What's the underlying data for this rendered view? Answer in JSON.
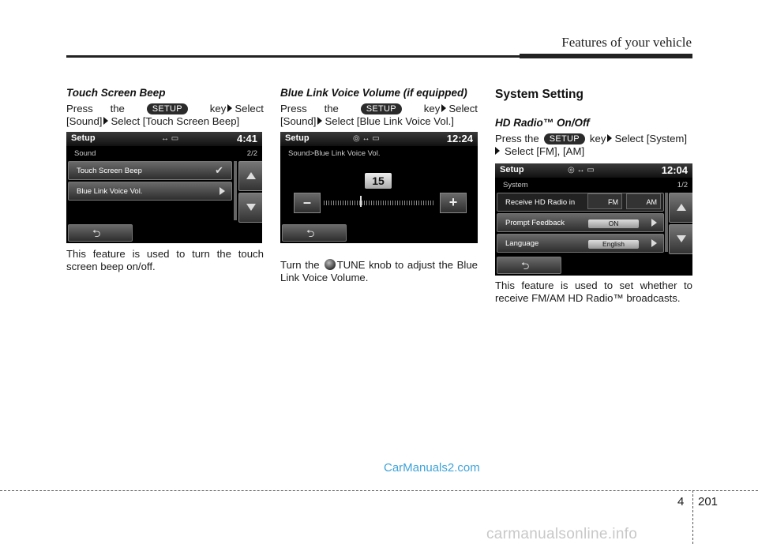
{
  "header": {
    "title": "Features of your vehicle"
  },
  "col1": {
    "subtitle": "Touch Screen Beep",
    "press": "Press",
    "the": "the",
    "setup": "SETUP",
    "key": "key",
    "select": "Select",
    "line2a": "[Sound]",
    "line2b": "Select [Touch Screen Beep]",
    "desc": "This feature is used to turn the touch screen beep on/off."
  },
  "screen1": {
    "title": "Setup",
    "usb": "↔ ▭",
    "time": "4:41",
    "subtitle": "Sound",
    "page": "2/2",
    "items": [
      {
        "label": "Touch Screen Beep",
        "check": "✔"
      },
      {
        "label": "Blue Link Voice Vol."
      }
    ],
    "back": "⮌"
  },
  "col2": {
    "subtitle": "Blue Link Voice Volume (if equipped)",
    "press": "Press",
    "the": "the",
    "setup": "SETUP",
    "key": "key",
    "select": "Select",
    "line2a": "[Sound]",
    "line2b": "Select [Blue Link Voice Vol.]",
    "desc_a": "Turn the",
    "desc_b": "TUNE knob to adjust the Blue Link Voice Volume."
  },
  "screen2": {
    "title": "Setup",
    "icons": "◎   ↔ ▭",
    "time": "12:24",
    "subtitle": "Sound>Blue Link Voice Vol.",
    "value": "15",
    "minus": "–",
    "plus": "+",
    "back": "⮌"
  },
  "col3": {
    "section": "System Setting",
    "subtitle": "HD Radio™ On/Off",
    "press": "Press the",
    "setup": "SETUP",
    "key": "key",
    "line1b": "Select [System]",
    "line2": "Select [FM], [AM]",
    "desc": "This feature is used to set whether to receive FM/AM HD Radio™ broadcasts."
  },
  "screen3": {
    "title": "Setup",
    "icons": "◎   ↔ ▭",
    "time": "12:04",
    "subtitle": "System",
    "page": "1/2",
    "rows": [
      {
        "label": "Receive HD Radio in",
        "opt1": "FM",
        "opt2": "AM"
      },
      {
        "label": "Prompt Feedback",
        "value": "ON"
      },
      {
        "label": "Language",
        "value": "English"
      }
    ],
    "back": "⮌"
  },
  "watermark": "CarManuals2.com",
  "footer": {
    "chapter": "4",
    "page": "201",
    "site": "carmanualsonline.info"
  }
}
